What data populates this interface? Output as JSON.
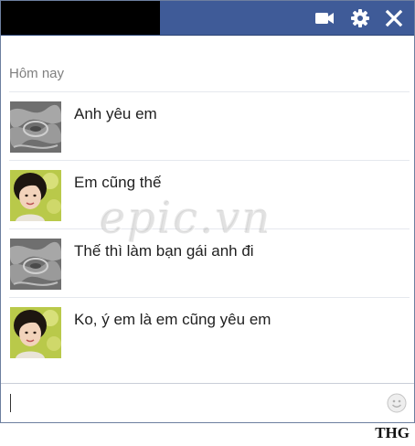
{
  "titlebar": {
    "contact_name": "",
    "icons": [
      "video-camera-icon",
      "gear-icon",
      "close-icon"
    ]
  },
  "conversation": {
    "day_label": "Hôm nay",
    "messages": [
      {
        "sender": "friend",
        "text": "Anh yêu em"
      },
      {
        "sender": "me",
        "text": "Em cũng thế"
      },
      {
        "sender": "friend",
        "text": "Thế thì làm bạn gái anh đi"
      },
      {
        "sender": "me",
        "text": "Ko, ý em là em cũng yêu em"
      }
    ]
  },
  "watermark": "epic.vn",
  "composer": {
    "value": "",
    "placeholder": "",
    "emoji_icon": "smiley-icon"
  },
  "credit": "THG",
  "colors": {
    "header": "#3f5b98",
    "separator": "#e5e8ee",
    "day_label": "#7f7f7f"
  }
}
